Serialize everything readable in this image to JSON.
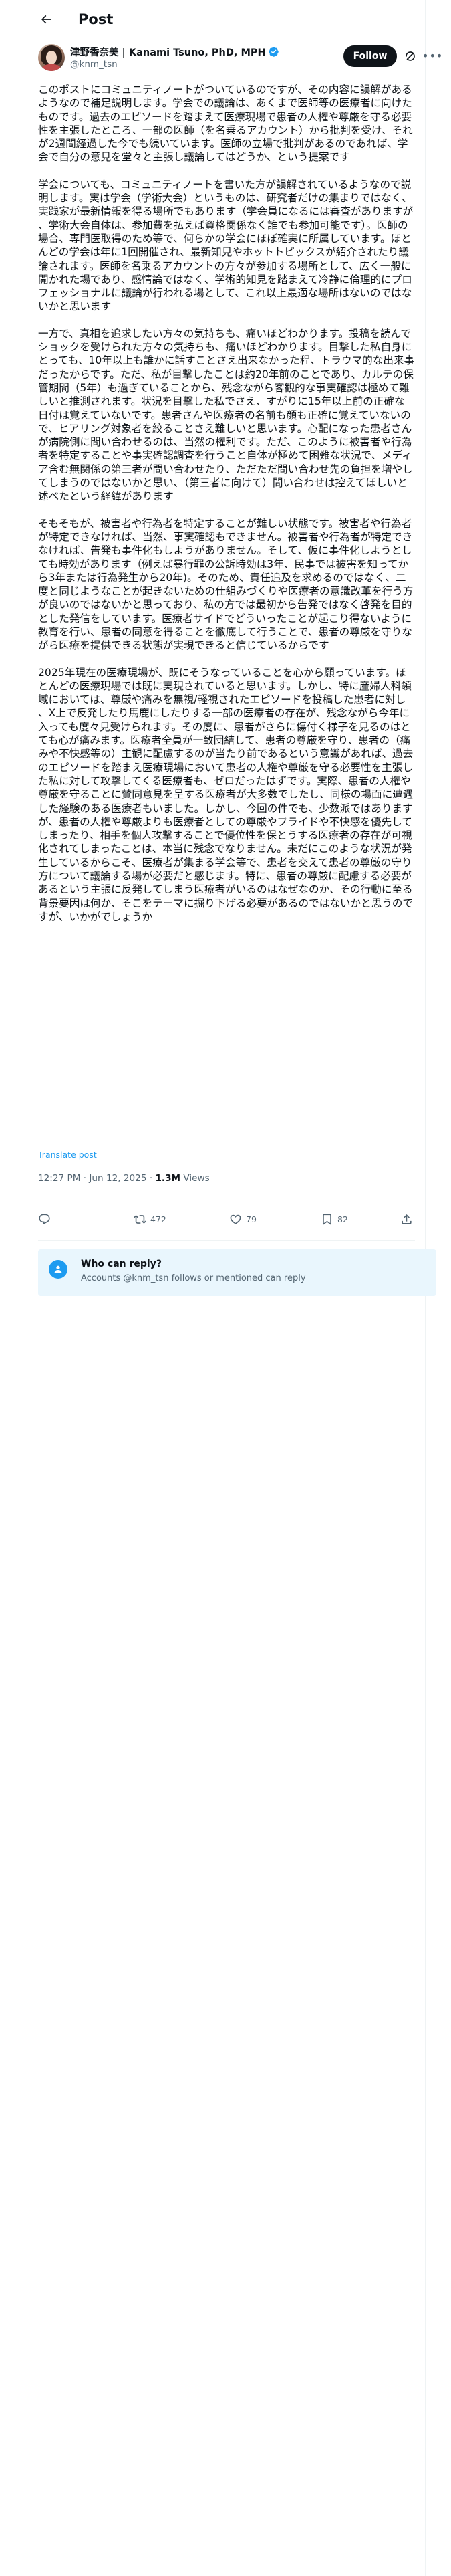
{
  "header": {
    "title": "Post"
  },
  "author": {
    "display_name": "津野香奈美 | Kanami Tsuno, PhD, MPH",
    "handle": "@knm_tsn",
    "follow_label": "Follow",
    "verified": true
  },
  "tweet": {
    "paragraphs": [
      "このポストにコミュニティノートがついているのですが、その内容に誤解があるようなので補足説明します。学会での議論は、あくまで医師等の医療者に向けたものです。過去のエピソードを踏まえて医療現場で患者の人権や尊厳を守る必要性を主張したところ、一部の医師（を名乗るアカウント）から批判を受け、それが2週間経過した今でも続いています。医師の立場で批判があるのであれば、学会で自分の意見を堂々と主張し議論してはどうか、という提案です",
      "学会についても、コミュニティノートを書いた方が誤解されているようなので説明します。実は学会（学術大会）というものは、研究者だけの集まりではなく、実践家が最新情報を得る場所でもあります（学会員になるには審査がありますが、学術大会自体は、参加費を払えば資格関係なく誰でも参加可能です）。医師の場合、専門医取得のため等で、何らかの学会にほぼ確実に所属しています。ほとんどの学会は年に1回開催され、最新知見やホットトピックスが紹介されたり議論されます。医師を名乗るアカウントの方々が参加する場所として、広く一般に開かれた場であり、感情論ではなく、学術的知見を踏まえて冷静に倫理的にプロフェッショナルに議論が行われる場として、これ以上最適な場所はないのではないかと思います",
      "一方で、真相を追求したい方々の気持ちも、痛いほどわかります。投稿を読んでショックを受けられた方々の気持ちも、痛いほどわかります。目撃した私自身にとっても、10年以上も誰かに話すことさえ出来なかった程、トラウマ的な出来事だったからです。ただ、私が目撃したことは約20年前のことであり、カルテの保管期間（5年）も過ぎていることから、残念ながら客観的な事実確認は極めて難しいと推測されます。状況を目撃した私でさえ、すがりに15年以上前の正確な日付は覚えていないです。患者さんや医療者の名前も顔も正確に覚えていないので、ヒアリング対象者を絞ることさえ難しいと思います。心配になった患者さんが病院側に問い合わせるのは、当然の権利です。ただ、このように被害者や行為者を特定することや事実確認調査を行うこと自体が極めて困難な状況で、メディア含む無関係の第三者が問い合わせたり、ただただ問い合わせ先の負担を増やしてしまうのではないかと思い、（第三者に向けて）問い合わせは控えてほしいと述べたという経緯があります",
      "そもそもが、被害者や行為者を特定することが難しい状態です。被害者や行為者が特定できなければ、当然、事実確認もできません。被害者や行為者が特定できなければ、告発も事件化もしようがありません。そして、仮に事件化しようとしても時効があります（例えば暴行罪の公訴時効は3年、民事では被害を知ってから3年または行為発生から20年)。そのため、責任追及を求めるのではなく、二度と同じようなことが起きないための仕組みづくりや医療者の意識改革を行う方が良いのではないかと思っており、私の方では最初から告発ではなく啓発を目的とした発信をしています。医療者サイドでどういったことが起こり得ないように教育を行い、患者の同意を得ることを徹底して行うことで、患者の尊厳を守りながら医療を提供できる状態が実現できると信じているからです",
      "2025年現在の医療現場が、既にそうなっていることを心から願っています。ほとんどの医療現場では既に実現されていると思います。しかし、特に産婦人科領域においては、尊厳や痛みを無視/軽視されたエピソードを投稿した患者に対し、X上で反発したり馬鹿にしたりする一部の医療者の存在が、残念ながら今年に入っても度々見受けられます。その度に、患者がさらに傷付く様子を見るのはとても心が痛みます。医療者全員が一致団結して、患者の尊厳を守り、患者の（痛みや不快感等の）主観に配慮するのが当たり前であるという意識があれば、過去のエピソードを踏まえ医療現場において患者の人権や尊厳を守る必要性を主張した私に対して攻撃してくる医療者も、ゼロだったはずです。実際、患者の人権や尊厳を守ることに賛同意見を呈する医療者が大多数でしたし、同様の場面に遭遇した経験のある医療者もいました。しかし、今回の件でも、少数派ではありますが、患者の人権や尊厳よりも医療者としての尊厳やプライドや不快感を優先してしまったり、相手を個人攻撃することで優位性を保とうする医療者の存在が可視化されてしまったことは、本当に残念でなりません。未だにこのような状況が発生しているからこそ、医療者が集まる学会等で、患者を交えて患者の尊厳の守り方について議論する場が必要だと感じます。特に、患者の尊厳に配慮する必要があるという主張に反発してしまう医療者がいるのはなぜなのか、その行動に至る背景要因は何か、そこをテーマに掘り下げる必要があるのではないかと思うのですが、いかがでしょうか"
    ],
    "translate_label": "Translate post",
    "time": "12:27 PM · Jun 12, 2025",
    "views_count": "1.3M",
    "views_label": "Views"
  },
  "actions": {
    "reply_count": "",
    "repost_count": "472",
    "like_count": "79",
    "bookmark_count": "82"
  },
  "reply_restriction": {
    "title": "Who can reply?",
    "subtitle": "Accounts @knm_tsn follows or mentioned can reply"
  },
  "colors": {
    "accent": "#1d9bf0",
    "text": "#0f1419",
    "muted": "#536471",
    "divider": "#eff3f4",
    "reply_box_bg": "#e9f6fd"
  },
  "icons": {
    "back": "arrow-left-icon",
    "verified": "verified-badge-icon",
    "grok": "grok-icon",
    "more": "more-horizontal-icon",
    "reply": "reply-icon",
    "repost": "repost-icon",
    "like": "heart-icon",
    "bookmark": "bookmark-icon",
    "share": "share-icon",
    "reply_restriction": "user-icon"
  }
}
